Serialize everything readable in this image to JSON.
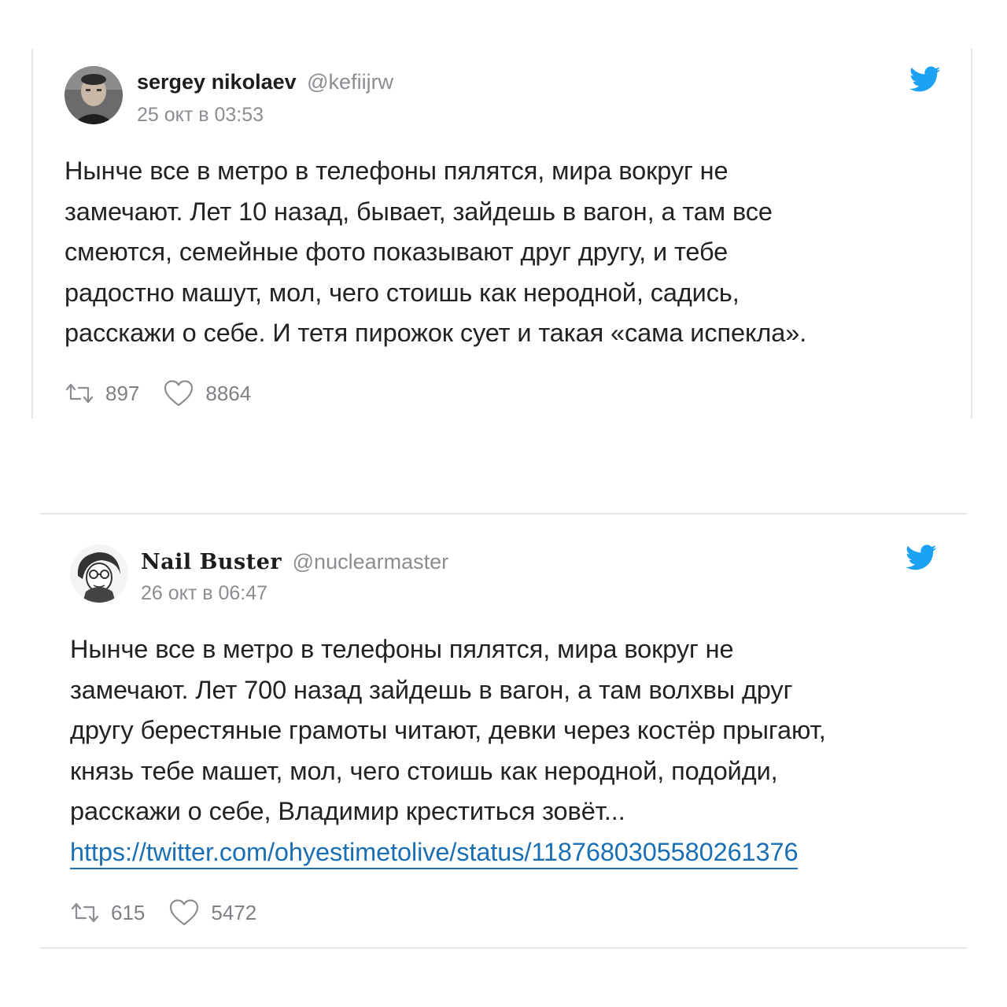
{
  "tweets": [
    {
      "display_name": "sergey nikolaev",
      "handle": "@kefiijrw",
      "date": "25 окт в 03:53",
      "lines": [
        "Нынче все в метро в телефоны пялятся, мира вокруг не",
        "замечают. Лет 10 назад, бывает, зайдешь в вагон, а там все",
        "смеются, семейные фото показывают друг другу, и тебе",
        "радостно машут, мол, чего стоишь как неродной, садись,",
        "расскажи о себе. И тетя пирожок сует и такая «сама испекла»."
      ],
      "retweets": "897",
      "likes": "8864",
      "avatar_icon": "avatar-photo-icon",
      "brand_icon": "twitter-bird-icon"
    },
    {
      "display_name": "Nail Buster",
      "handle": "@nuclearmaster",
      "date": "26 окт в 06:47",
      "lines": [
        "Нынче все в метро в телефоны пялятся, мира вокруг не",
        "замечают. Лет 700 назад зайдешь в вагон, а там волхвы друг",
        "другу берестяные грамоты читают, девки через костёр прыгают,",
        "князь тебе машет, мол, чего стоишь как неродной, подойди,",
        "расскажи о себе, Владимир креститься зовёт..."
      ],
      "link": "https://twitter.com/ohyestimetolive/status/1187680305580261376",
      "retweets": "615",
      "likes": "5472",
      "avatar_icon": "avatar-sketch-icon",
      "brand_icon": "twitter-bird-icon"
    }
  ],
  "colors": {
    "twitter_blue": "#1da1f2",
    "link_blue": "#1a6fb4",
    "muted_gray": "#8a8d91"
  }
}
